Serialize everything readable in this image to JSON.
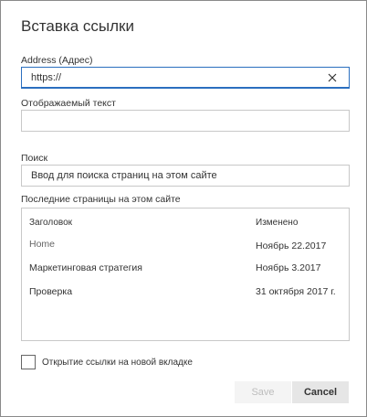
{
  "dialog": {
    "title": "Вставка ссылки",
    "address": {
      "label": "Address (Адрес)",
      "value": "https://"
    },
    "display_text": {
      "label": "Отображаемый текст",
      "value": ""
    },
    "search": {
      "label": "Поиск",
      "placeholder": "Ввод для поиска страниц на этом сайте"
    },
    "recent": {
      "label": "Последние страницы на этом сайте",
      "columns": [
        "Заголовок",
        "Изменено"
      ],
      "rows": [
        {
          "title": "Home",
          "modified": "Ноябрь 22.2017"
        },
        {
          "title": "Маркетинговая стратегия",
          "modified": "Ноябрь 3.2017"
        },
        {
          "title": "Проверка",
          "modified": "31 октября 2017 г."
        }
      ]
    },
    "new_tab": {
      "label": "Открытие ссылки на новой вкладке",
      "checked": false
    },
    "buttons": {
      "save": "Save",
      "cancel": "Cancel"
    },
    "colors": {
      "accent": "#2b6fbf",
      "border": "#c8c8c8",
      "disabled_text": "#bdbdbd"
    }
  }
}
